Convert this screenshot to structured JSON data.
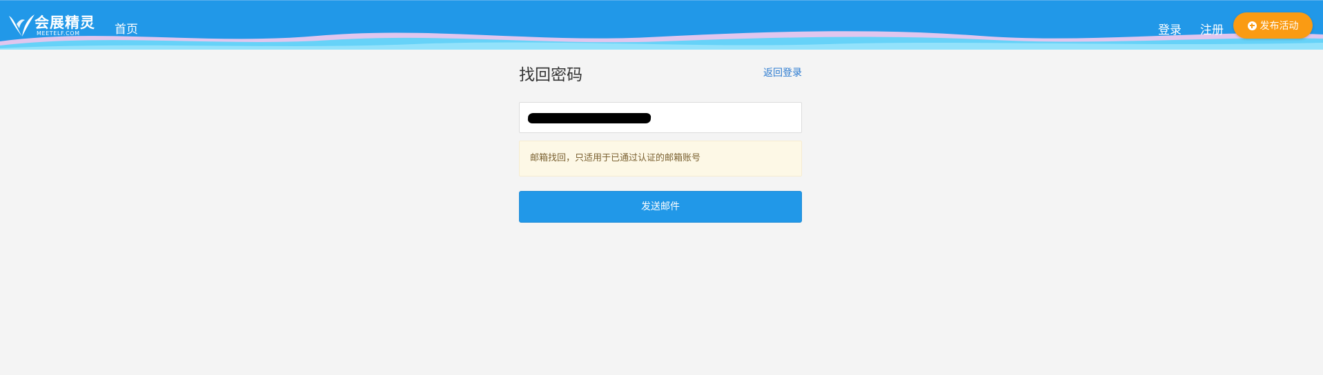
{
  "header": {
    "logo_title": "会展精灵",
    "logo_subtitle": "MEETELF.COM",
    "nav_home": "首页",
    "nav_login": "登录",
    "nav_register": "注册",
    "publish_button": "发布活动"
  },
  "form": {
    "title": "找回密码",
    "back_to_login": "返回登录",
    "email_value": "",
    "notice": "邮箱找回，只适用于已通过认证的邮箱账号",
    "send_button": "发送邮件"
  },
  "colors": {
    "header_bg": "#2198e8",
    "publish_button": "#fa9b13",
    "page_bg": "#f4f4f4",
    "notice_bg": "#fdf8e6",
    "primary_button": "#2198e8"
  }
}
